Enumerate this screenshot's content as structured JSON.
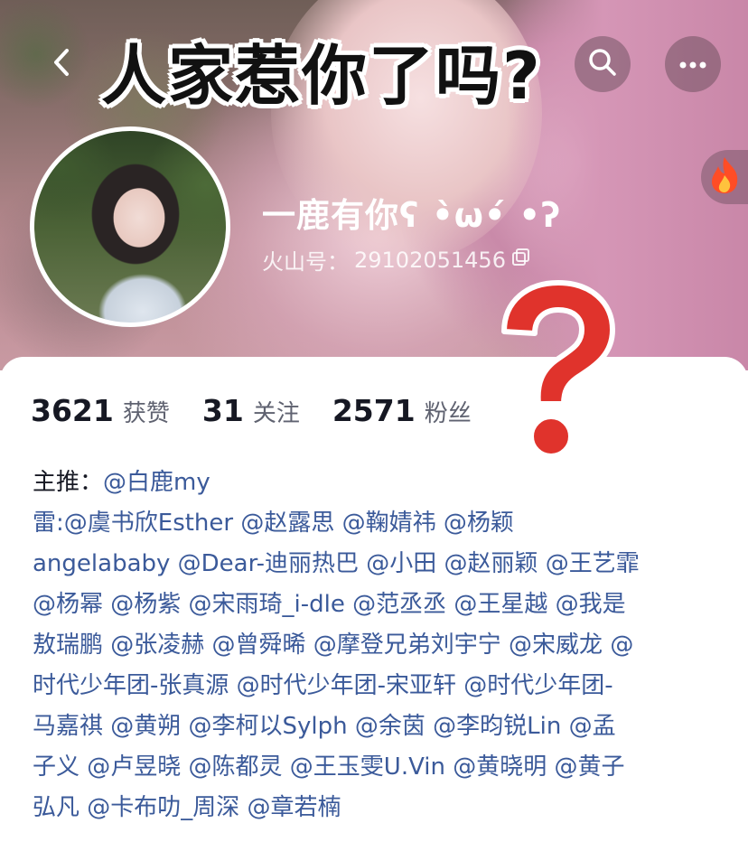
{
  "header": {
    "meme_title": "人家惹你了吗?",
    "back_icon": "chevron-left-icon",
    "search_icon": "search-icon",
    "more_icon": "more-icon",
    "fire_icon": "fire-icon"
  },
  "profile": {
    "nickname": "一鹿有你ʕ •̀ω•́ •ʔ",
    "uid_label": "火山号：",
    "uid_value": "29102051456"
  },
  "stats": [
    {
      "value": "3621",
      "label": "获赞"
    },
    {
      "value": "31",
      "label": "关注"
    },
    {
      "value": "2571",
      "label": "粉丝"
    }
  ],
  "bio": {
    "line1_prefix": "主推：",
    "line1_mention": "@白鹿my",
    "lines": [
      "雷:@虞书欣Esther @赵露思 @鞠婧祎 @杨颖",
      "angelababy @Dear-迪丽热巴 @小田 @赵丽颖 @王艺霏",
      "@杨幂 @杨紫 @宋雨琦_i-dle @范丞丞 @王星越 @我是",
      "敖瑞鹏 @张凌赫  @曾舜晞 @摩登兄弟刘宇宁 @宋威龙 @",
      "时代少年团-张真源 @时代少年团-宋亚轩  @时代少年团-",
      "马嘉祺 @黄朔 @李柯以Sylph @余茵 @李昀锐Lin @孟",
      "子义 @卢昱晓 @陈都灵 @王玉雯U.Vin @黄晓明 @黄子",
      "弘凡 @卡布叻_周深 @章若楠"
    ]
  },
  "colors": {
    "mention": "#3b5a9a",
    "question_mark": "#e0332c"
  }
}
